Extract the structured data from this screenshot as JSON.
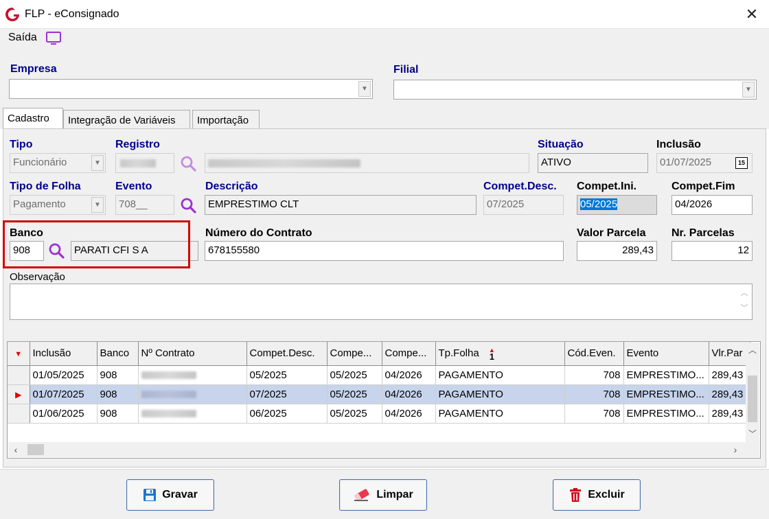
{
  "window": {
    "title": "FLP - eConsignado",
    "close_glyph": "✕"
  },
  "menu": {
    "saida": "Saída"
  },
  "top": {
    "empresa_label": "Empresa",
    "empresa_value": "",
    "filial_label": "Filial",
    "filial_value": ""
  },
  "tabs": [
    "Cadastro",
    "Integração de Variáveis",
    "Importação"
  ],
  "form": {
    "tipo": {
      "label": "Tipo",
      "value": "Funcionário"
    },
    "registro": {
      "label": "Registro"
    },
    "situacao": {
      "label": "Situação",
      "value": "ATIVO"
    },
    "inclusao": {
      "label": "Inclusão",
      "value": "01/07/2025",
      "calendar_badge": "15"
    },
    "tipo_folha": {
      "label": "Tipo de Folha",
      "value": "Pagamento"
    },
    "evento": {
      "label": "Evento",
      "value": "708__"
    },
    "descricao": {
      "label": "Descrição",
      "value": "EMPRESTIMO CLT"
    },
    "compet_desc": {
      "label": "Compet.Desc.",
      "value": "07/2025"
    },
    "compet_ini": {
      "label": "Compet.Ini.",
      "value": "05/2025"
    },
    "compet_fim": {
      "label": "Compet.Fim",
      "value": "04/2026"
    },
    "banco": {
      "label": "Banco",
      "code": "908",
      "name": "PARATI CFI S A"
    },
    "numero_contrato": {
      "label": "Número do Contrato",
      "value": "678155580"
    },
    "valor_parcela": {
      "label": "Valor Parcela",
      "value": "289,43"
    },
    "nr_parcelas": {
      "label": "Nr. Parcelas",
      "value": "12"
    },
    "observacao": {
      "label": "Observação",
      "value": ""
    }
  },
  "grid": {
    "sort_marker": "1",
    "columns": [
      "Inclusão",
      "Banco",
      "Nº Contrato",
      "Compet.Desc.",
      "Compe...",
      "Compe...",
      "Tp.Folha",
      "Cód.Even.",
      "Evento",
      "Vlr.Par"
    ],
    "rows": [
      {
        "inclusao": "01/05/2025",
        "banco": "908",
        "contrato": "",
        "compet_desc": "05/2025",
        "compet_ini": "05/2025",
        "compet_fim": "04/2026",
        "tp_folha": "PAGAMENTO",
        "cod_evento": "708",
        "evento": "EMPRESTIMO...",
        "vlr_parcela": "289,43"
      },
      {
        "inclusao": "01/07/2025",
        "banco": "908",
        "contrato": "",
        "compet_desc": "07/2025",
        "compet_ini": "05/2025",
        "compet_fim": "04/2026",
        "tp_folha": "PAGAMENTO",
        "cod_evento": "708",
        "evento": "EMPRESTIMO...",
        "vlr_parcela": "289,43"
      },
      {
        "inclusao": "01/06/2025",
        "banco": "908",
        "contrato": "",
        "compet_desc": "06/2025",
        "compet_ini": "05/2025",
        "compet_fim": "04/2026",
        "tp_folha": "PAGAMENTO",
        "cod_evento": "708",
        "evento": "EMPRESTIMO...",
        "vlr_parcela": "289,43"
      }
    ]
  },
  "buttons": {
    "gravar": "Gravar",
    "limpar": "Limpar",
    "excluir": "Excluir"
  },
  "colors": {
    "label_blue": "#00008b",
    "accent_purple": "#9b30d0",
    "selection": "#0078d7",
    "highlight_red": "#d40000"
  }
}
